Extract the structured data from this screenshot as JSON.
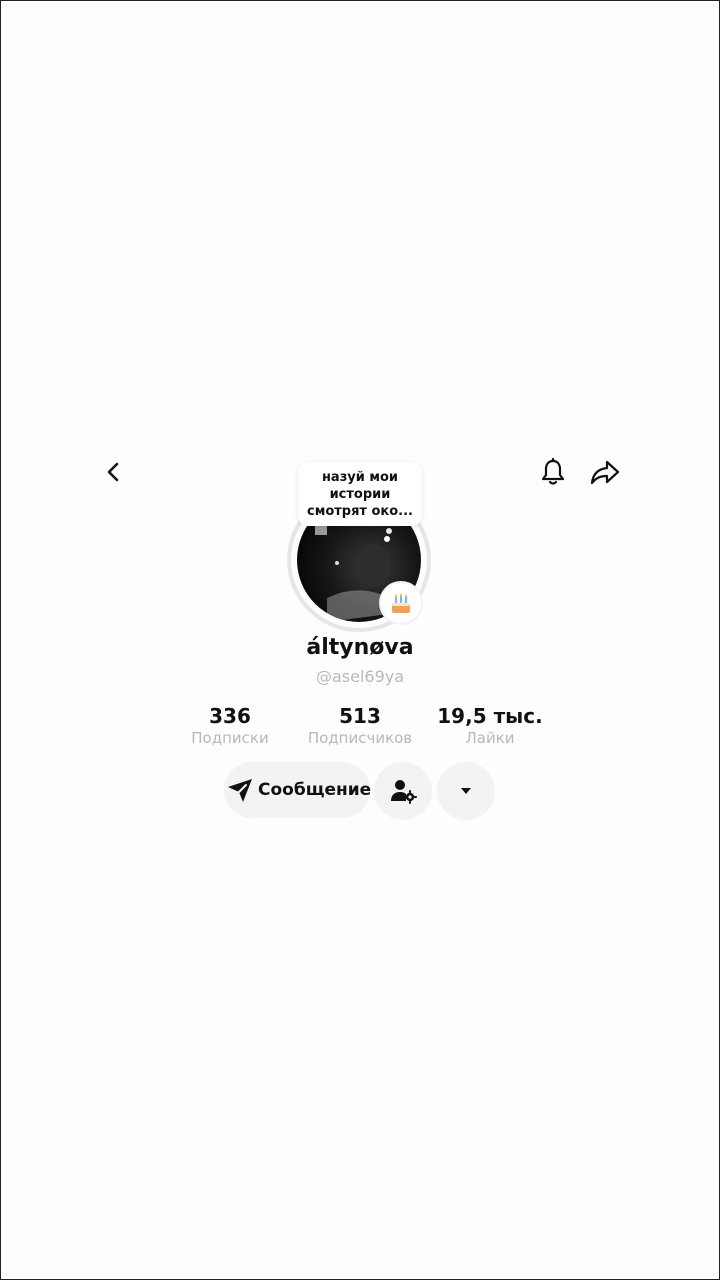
{
  "header": {
    "back_icon": "chevron-left-icon",
    "bell_icon": "bell-icon",
    "share_icon": "share-arrow-icon"
  },
  "profile": {
    "note_line1": "назуй мои",
    "note_line2": "истории",
    "note_line3": "смотрят око...",
    "display_name": "áltynøva",
    "username": "@asel69ya",
    "badge_icon": "birthday-cake-icon"
  },
  "stats": [
    {
      "value": "336",
      "label": "Подписки"
    },
    {
      "value": "513",
      "label": "Подписчиков"
    },
    {
      "value": "19,5 тыс.",
      "label": "Лайки"
    }
  ],
  "actions": {
    "message_label": "Сообщение",
    "message_icon": "send-arrow-icon",
    "person_icon": "person-settings-icon",
    "more_icon": "caret-down-icon"
  },
  "colors": {
    "background": "#fdfdfd",
    "button_bg": "#f3f3f3",
    "secondary_text": "#b8b8b8"
  }
}
